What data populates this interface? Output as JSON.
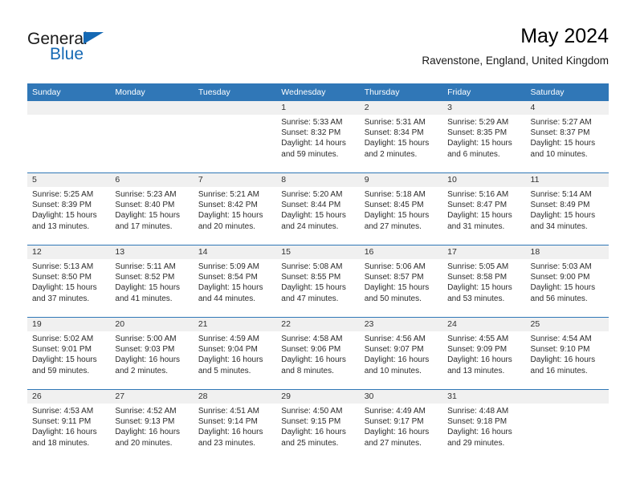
{
  "brand": {
    "name_part1": "General",
    "name_part2": "Blue",
    "triangle_icon": "triangle-icon",
    "color_blue": "#1569b4"
  },
  "header": {
    "title": "May 2024",
    "location": "Ravenstone, England, United Kingdom"
  },
  "theme": {
    "header_band": "#3077b7",
    "daynum_band": "#f0f0f0",
    "row_separator": "#3077b7"
  },
  "weekday_headers": [
    "Sunday",
    "Monday",
    "Tuesday",
    "Wednesday",
    "Thursday",
    "Friday",
    "Saturday"
  ],
  "labels": {
    "sunrise_prefix": "Sunrise:",
    "sunset_prefix": "Sunset:",
    "daylight_prefix": "Daylight:"
  },
  "weeks": [
    [
      {
        "day": "",
        "empty": true
      },
      {
        "day": "",
        "empty": true
      },
      {
        "day": "",
        "empty": true
      },
      {
        "day": "1",
        "sunrise": "Sunrise: 5:33 AM",
        "sunset": "Sunset: 8:32 PM",
        "daylight": "Daylight: 14 hours and 59 minutes."
      },
      {
        "day": "2",
        "sunrise": "Sunrise: 5:31 AM",
        "sunset": "Sunset: 8:34 PM",
        "daylight": "Daylight: 15 hours and 2 minutes."
      },
      {
        "day": "3",
        "sunrise": "Sunrise: 5:29 AM",
        "sunset": "Sunset: 8:35 PM",
        "daylight": "Daylight: 15 hours and 6 minutes."
      },
      {
        "day": "4",
        "sunrise": "Sunrise: 5:27 AM",
        "sunset": "Sunset: 8:37 PM",
        "daylight": "Daylight: 15 hours and 10 minutes."
      }
    ],
    [
      {
        "day": "5",
        "sunrise": "Sunrise: 5:25 AM",
        "sunset": "Sunset: 8:39 PM",
        "daylight": "Daylight: 15 hours and 13 minutes."
      },
      {
        "day": "6",
        "sunrise": "Sunrise: 5:23 AM",
        "sunset": "Sunset: 8:40 PM",
        "daylight": "Daylight: 15 hours and 17 minutes."
      },
      {
        "day": "7",
        "sunrise": "Sunrise: 5:21 AM",
        "sunset": "Sunset: 8:42 PM",
        "daylight": "Daylight: 15 hours and 20 minutes."
      },
      {
        "day": "8",
        "sunrise": "Sunrise: 5:20 AM",
        "sunset": "Sunset: 8:44 PM",
        "daylight": "Daylight: 15 hours and 24 minutes."
      },
      {
        "day": "9",
        "sunrise": "Sunrise: 5:18 AM",
        "sunset": "Sunset: 8:45 PM",
        "daylight": "Daylight: 15 hours and 27 minutes."
      },
      {
        "day": "10",
        "sunrise": "Sunrise: 5:16 AM",
        "sunset": "Sunset: 8:47 PM",
        "daylight": "Daylight: 15 hours and 31 minutes."
      },
      {
        "day": "11",
        "sunrise": "Sunrise: 5:14 AM",
        "sunset": "Sunset: 8:49 PM",
        "daylight": "Daylight: 15 hours and 34 minutes."
      }
    ],
    [
      {
        "day": "12",
        "sunrise": "Sunrise: 5:13 AM",
        "sunset": "Sunset: 8:50 PM",
        "daylight": "Daylight: 15 hours and 37 minutes."
      },
      {
        "day": "13",
        "sunrise": "Sunrise: 5:11 AM",
        "sunset": "Sunset: 8:52 PM",
        "daylight": "Daylight: 15 hours and 41 minutes."
      },
      {
        "day": "14",
        "sunrise": "Sunrise: 5:09 AM",
        "sunset": "Sunset: 8:54 PM",
        "daylight": "Daylight: 15 hours and 44 minutes."
      },
      {
        "day": "15",
        "sunrise": "Sunrise: 5:08 AM",
        "sunset": "Sunset: 8:55 PM",
        "daylight": "Daylight: 15 hours and 47 minutes."
      },
      {
        "day": "16",
        "sunrise": "Sunrise: 5:06 AM",
        "sunset": "Sunset: 8:57 PM",
        "daylight": "Daylight: 15 hours and 50 minutes."
      },
      {
        "day": "17",
        "sunrise": "Sunrise: 5:05 AM",
        "sunset": "Sunset: 8:58 PM",
        "daylight": "Daylight: 15 hours and 53 minutes."
      },
      {
        "day": "18",
        "sunrise": "Sunrise: 5:03 AM",
        "sunset": "Sunset: 9:00 PM",
        "daylight": "Daylight: 15 hours and 56 minutes."
      }
    ],
    [
      {
        "day": "19",
        "sunrise": "Sunrise: 5:02 AM",
        "sunset": "Sunset: 9:01 PM",
        "daylight": "Daylight: 15 hours and 59 minutes."
      },
      {
        "day": "20",
        "sunrise": "Sunrise: 5:00 AM",
        "sunset": "Sunset: 9:03 PM",
        "daylight": "Daylight: 16 hours and 2 minutes."
      },
      {
        "day": "21",
        "sunrise": "Sunrise: 4:59 AM",
        "sunset": "Sunset: 9:04 PM",
        "daylight": "Daylight: 16 hours and 5 minutes."
      },
      {
        "day": "22",
        "sunrise": "Sunrise: 4:58 AM",
        "sunset": "Sunset: 9:06 PM",
        "daylight": "Daylight: 16 hours and 8 minutes."
      },
      {
        "day": "23",
        "sunrise": "Sunrise: 4:56 AM",
        "sunset": "Sunset: 9:07 PM",
        "daylight": "Daylight: 16 hours and 10 minutes."
      },
      {
        "day": "24",
        "sunrise": "Sunrise: 4:55 AM",
        "sunset": "Sunset: 9:09 PM",
        "daylight": "Daylight: 16 hours and 13 minutes."
      },
      {
        "day": "25",
        "sunrise": "Sunrise: 4:54 AM",
        "sunset": "Sunset: 9:10 PM",
        "daylight": "Daylight: 16 hours and 16 minutes."
      }
    ],
    [
      {
        "day": "26",
        "sunrise": "Sunrise: 4:53 AM",
        "sunset": "Sunset: 9:11 PM",
        "daylight": "Daylight: 16 hours and 18 minutes."
      },
      {
        "day": "27",
        "sunrise": "Sunrise: 4:52 AM",
        "sunset": "Sunset: 9:13 PM",
        "daylight": "Daylight: 16 hours and 20 minutes."
      },
      {
        "day": "28",
        "sunrise": "Sunrise: 4:51 AM",
        "sunset": "Sunset: 9:14 PM",
        "daylight": "Daylight: 16 hours and 23 minutes."
      },
      {
        "day": "29",
        "sunrise": "Sunrise: 4:50 AM",
        "sunset": "Sunset: 9:15 PM",
        "daylight": "Daylight: 16 hours and 25 minutes."
      },
      {
        "day": "30",
        "sunrise": "Sunrise: 4:49 AM",
        "sunset": "Sunset: 9:17 PM",
        "daylight": "Daylight: 16 hours and 27 minutes."
      },
      {
        "day": "31",
        "sunrise": "Sunrise: 4:48 AM",
        "sunset": "Sunset: 9:18 PM",
        "daylight": "Daylight: 16 hours and 29 minutes."
      },
      {
        "day": "",
        "empty": true
      }
    ]
  ]
}
